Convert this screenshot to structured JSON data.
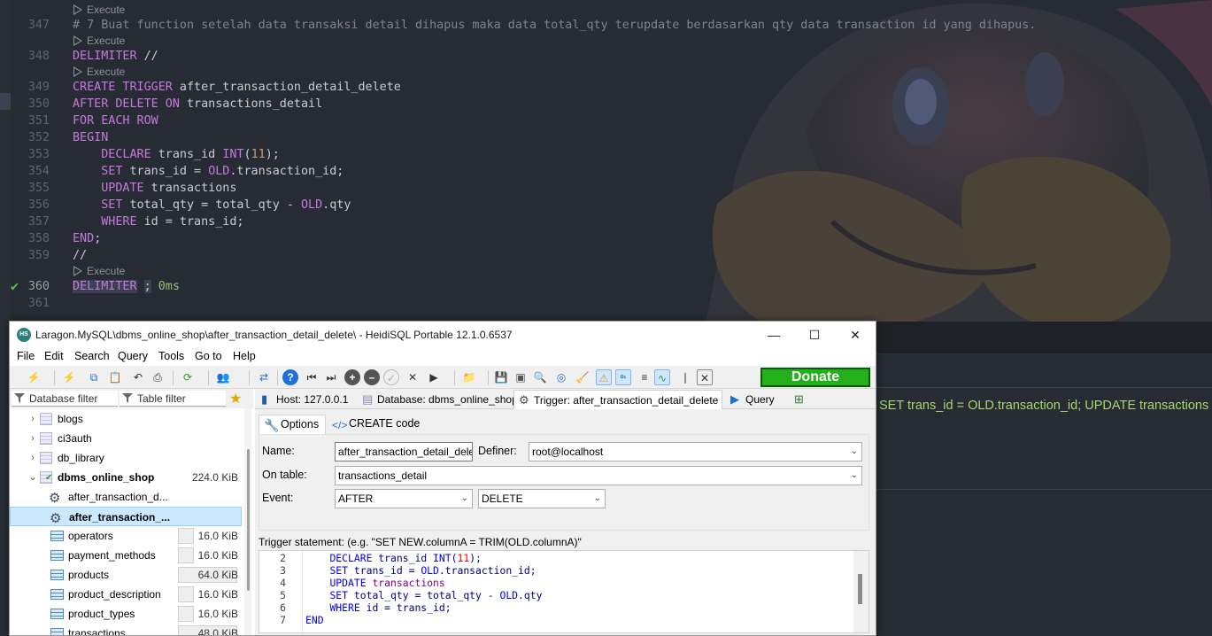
{
  "editor": {
    "lens_label": "Execute",
    "lines": [
      {
        "n": "347",
        "segs": [
          {
            "c": "cmt",
            "t": "# 7 Buat function setelah data transaksi detail dihapus maka data total_qty terupdate berdasarkan qty data transaction id yang dihapus."
          }
        ]
      },
      {
        "n": "348",
        "segs": [
          {
            "c": "kw",
            "t": "DELIMITER"
          },
          {
            "c": "",
            "t": " //"
          }
        ]
      },
      {
        "n": "349",
        "segs": [
          {
            "c": "kw",
            "t": "CREATE TRIGGER"
          },
          {
            "c": "",
            "t": " after_transaction_detail_delete"
          }
        ]
      },
      {
        "n": "350",
        "segs": [
          {
            "c": "kw",
            "t": "AFTER DELETE ON"
          },
          {
            "c": "",
            "t": " transactions_detail"
          }
        ]
      },
      {
        "n": "351",
        "segs": [
          {
            "c": "kw",
            "t": "FOR EACH ROW"
          }
        ]
      },
      {
        "n": "352",
        "segs": [
          {
            "c": "kw",
            "t": "BEGIN"
          }
        ]
      },
      {
        "n": "353",
        "segs": [
          {
            "c": "",
            "t": "    "
          },
          {
            "c": "kw",
            "t": "DECLARE"
          },
          {
            "c": "",
            "t": " trans_id "
          },
          {
            "c": "kw",
            "t": "INT"
          },
          {
            "c": "",
            "t": "("
          },
          {
            "c": "num",
            "t": "11"
          },
          {
            "c": "",
            "t": ");"
          }
        ]
      },
      {
        "n": "354",
        "segs": [
          {
            "c": "",
            "t": "    "
          },
          {
            "c": "kw",
            "t": "SET"
          },
          {
            "c": "",
            "t": " trans_id = "
          },
          {
            "c": "kw",
            "t": "OLD"
          },
          {
            "c": "",
            "t": ".transaction_id;"
          }
        ]
      },
      {
        "n": "355",
        "segs": [
          {
            "c": "",
            "t": "    "
          },
          {
            "c": "kw",
            "t": "UPDATE"
          },
          {
            "c": "",
            "t": " transactions"
          }
        ]
      },
      {
        "n": "356",
        "segs": [
          {
            "c": "",
            "t": "    "
          },
          {
            "c": "kw",
            "t": "SET"
          },
          {
            "c": "",
            "t": " total_qty = total_qty - "
          },
          {
            "c": "kw",
            "t": "OLD"
          },
          {
            "c": "",
            "t": ".qty"
          }
        ]
      },
      {
        "n": "357",
        "segs": [
          {
            "c": "",
            "t": "    "
          },
          {
            "c": "kw",
            "t": "WHERE"
          },
          {
            "c": "",
            "t": " id = trans_id;"
          }
        ]
      },
      {
        "n": "358",
        "segs": [
          {
            "c": "kw",
            "t": "END"
          },
          {
            "c": "",
            "t": ";"
          }
        ]
      },
      {
        "n": "359",
        "segs": [
          {
            "c": "",
            "t": "//"
          }
        ]
      },
      {
        "n": "360",
        "segs": [
          {
            "c": "selword kw",
            "t": "DELIMITER"
          },
          {
            "c": "",
            "t": " "
          },
          {
            "c": "selword",
            "t": ";"
          },
          {
            "c": "",
            "t": " "
          },
          {
            "c": "grn",
            "t": "0ms"
          }
        ]
      },
      {
        "n": "361",
        "segs": []
      }
    ],
    "result_text": "SET trans_id = OLD.transaction_id; UPDATE transactions SET total_qty = total_qty - OLD.qty WHERE id = trans_id; END"
  },
  "heidi": {
    "title": "Laragon.MySQL\\dbms_online_shop\\after_transaction_detail_delete\\ - HeidiSQL Portable 12.1.0.6537",
    "app_icon_text": "HS",
    "window_buttons": {
      "minimize": "—",
      "maximize": "☐",
      "close": "✕"
    },
    "menu": [
      "File",
      "Edit",
      "Search",
      "Query",
      "Tools",
      "Go to",
      "Help"
    ],
    "donate_label": "Donate",
    "filters": {
      "database": "Database filter",
      "table": "Table filter"
    },
    "tree": [
      {
        "kind": "db",
        "label": "blogs",
        "expand": "›"
      },
      {
        "kind": "db",
        "label": "ci3auth",
        "expand": "›"
      },
      {
        "kind": "db",
        "label": "db_library",
        "expand": "›"
      },
      {
        "kind": "dbopen",
        "label": "dbms_online_shop",
        "expand": "⌄",
        "size": "224.0 KiB"
      },
      {
        "kind": "trigger",
        "label": "after_transaction_d..."
      },
      {
        "kind": "trigger",
        "label": "after_transaction_...",
        "selected": true
      },
      {
        "kind": "table",
        "label": "operators",
        "size": "16.0 KiB"
      },
      {
        "kind": "table",
        "label": "payment_methods",
        "size": "16.0 KiB"
      },
      {
        "kind": "table",
        "label": "products",
        "size": "64.0 KiB",
        "big": true
      },
      {
        "kind": "table",
        "label": "product_description",
        "size": "16.0 KiB"
      },
      {
        "kind": "table",
        "label": "product_types",
        "size": "16.0 KiB"
      },
      {
        "kind": "table",
        "label": "transactions",
        "size": "48.0 KiB",
        "big": true
      }
    ],
    "tabs": {
      "host": "Host: 127.0.0.1",
      "database": "Database: dbms_online_shop",
      "trigger": "Trigger: after_transaction_detail_delete",
      "query": "Query"
    },
    "subtabs": {
      "options": "Options",
      "create_code": "CREATE code"
    },
    "form": {
      "name_label": "Name:",
      "name_value": "after_transaction_detail_delete",
      "definer_label": "Definer:",
      "definer_value": "root@localhost",
      "table_label": "On table:",
      "table_value": "transactions_detail",
      "event_label": "Event:",
      "timing_value": "AFTER",
      "event_value": "DELETE"
    },
    "statement_label": "Trigger statement: (e.g. \"SET NEW.columnA = TRIM(OLD.columnA)\"",
    "statement_lines": [
      {
        "n": "2",
        "segs": [
          {
            "c": "",
            "t": "    "
          },
          {
            "c": "skw",
            "t": "DECLARE"
          },
          {
            "c": "",
            "t": " trans_id "
          },
          {
            "c": "skw",
            "t": "INT"
          },
          {
            "c": "",
            "t": "("
          },
          {
            "c": "snum",
            "t": "11"
          },
          {
            "c": "",
            "t": ");"
          }
        ]
      },
      {
        "n": "3",
        "segs": [
          {
            "c": "",
            "t": "    "
          },
          {
            "c": "skw",
            "t": "SET"
          },
          {
            "c": "",
            "t": " trans_id = "
          },
          {
            "c": "skw",
            "t": "OLD"
          },
          {
            "c": "",
            "t": ".transaction_id;"
          }
        ]
      },
      {
        "n": "4",
        "segs": [
          {
            "c": "",
            "t": "    "
          },
          {
            "c": "skw",
            "t": "UPDATE"
          },
          {
            "c": "sid",
            "t": " transactions"
          }
        ]
      },
      {
        "n": "5",
        "segs": [
          {
            "c": "",
            "t": "    "
          },
          {
            "c": "skw",
            "t": "SET"
          },
          {
            "c": "",
            "t": " total_qty = total_qty - "
          },
          {
            "c": "skw",
            "t": "OLD"
          },
          {
            "c": "",
            "t": ".qty"
          }
        ]
      },
      {
        "n": "6",
        "segs": [
          {
            "c": "",
            "t": "    "
          },
          {
            "c": "skw",
            "t": "WHERE"
          },
          {
            "c": "",
            "t": " id = trans_id;"
          }
        ]
      },
      {
        "n": "7",
        "segs": [
          {
            "c": "skw",
            "t": "END"
          }
        ]
      }
    ],
    "toolbar_icons": [
      "disconnect-icon",
      "new-connection-icon",
      "copy-icon",
      "paste-icon",
      "undo-icon",
      "print-icon",
      "refresh-icon",
      "user-manager-icon",
      "maintenance-icon",
      "help-icon",
      "first-icon",
      "last-icon",
      "add-icon",
      "delete-icon",
      "post-icon",
      "cancel-icon",
      "run-icon",
      "open-icon",
      "save-icon",
      "save-snippet-icon",
      "find-icon",
      "replace-icon",
      "format-icon",
      "warnings-icon",
      "binary-icon",
      "wrap-icon",
      "single-query-icon",
      "clear-icon",
      "exit-icon"
    ],
    "colors": {
      "donate": "#23b01a",
      "selection": "#cce8ff",
      "editor_bg": "#272c34",
      "result_text": "#a7d86d"
    }
  }
}
